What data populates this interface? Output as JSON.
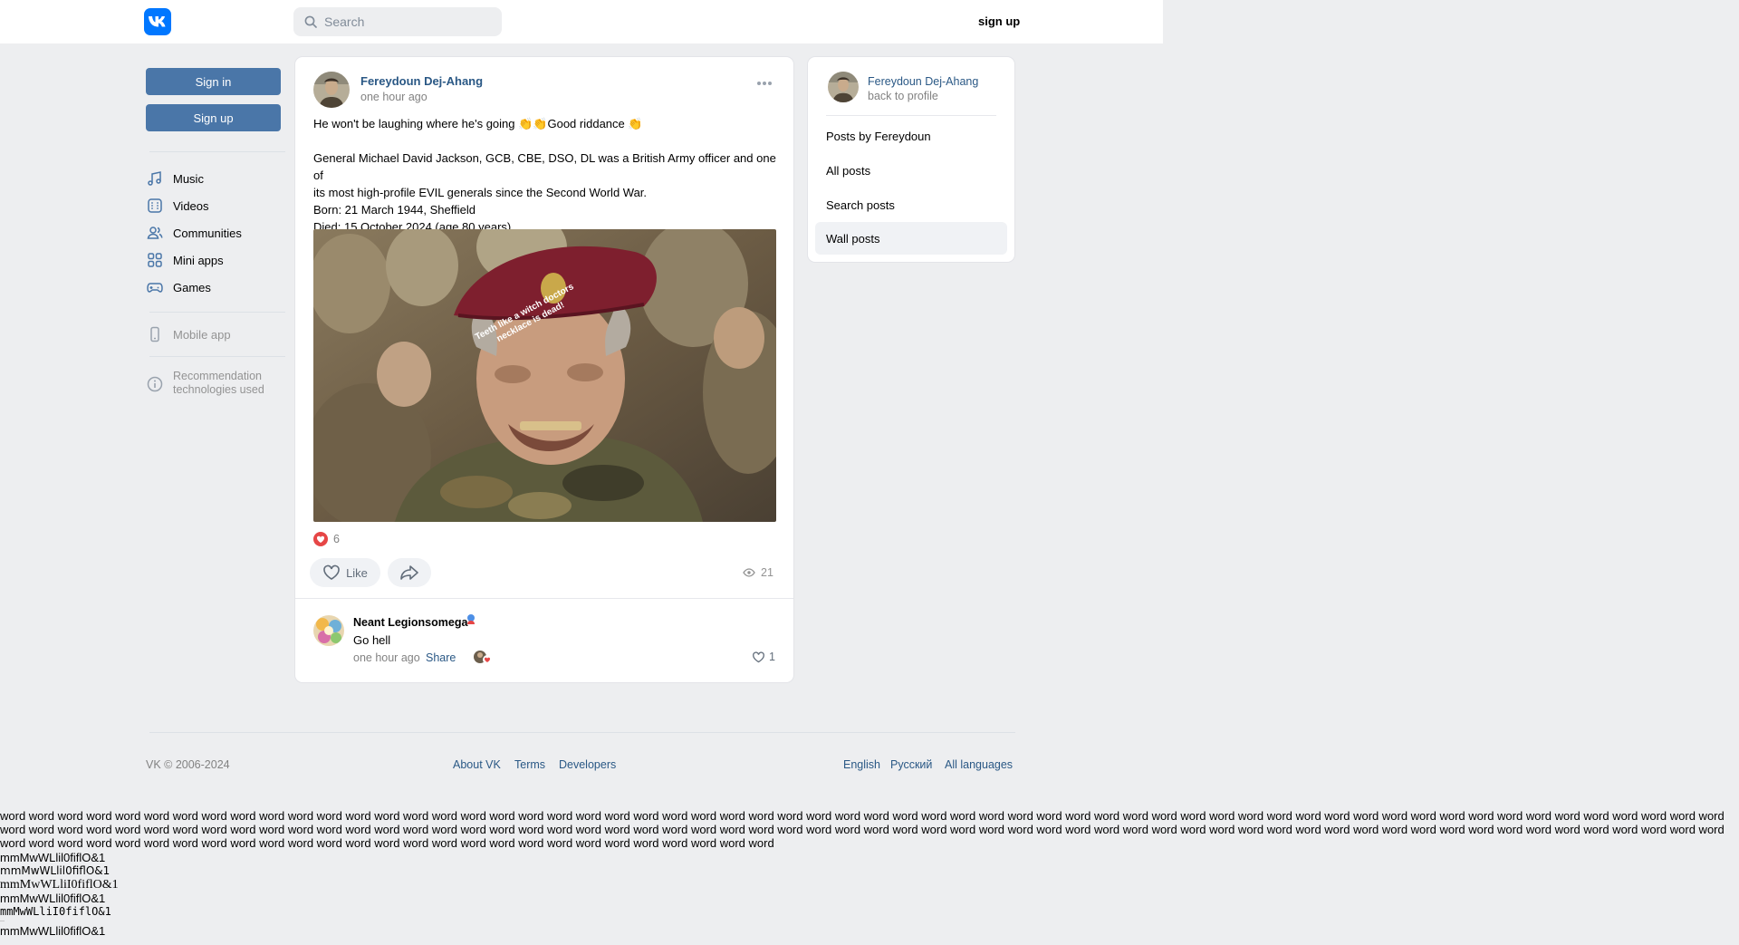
{
  "header": {
    "search_placeholder": "Search",
    "signup_label": "sign up"
  },
  "sidebar": {
    "sign_in": "Sign in",
    "sign_up": "Sign up",
    "items": [
      {
        "label": "Music",
        "icon": "music-icon"
      },
      {
        "label": "Videos",
        "icon": "videos-icon"
      },
      {
        "label": "Communities",
        "icon": "communities-icon"
      },
      {
        "label": "Mini apps",
        "icon": "mini-apps-icon"
      },
      {
        "label": "Games",
        "icon": "games-icon"
      }
    ],
    "mobile_app": "Mobile app",
    "recommendation_line1": "Recommendation",
    "recommendation_line2": "technologies used"
  },
  "post": {
    "author": "Fereydoun Dej-Ahang",
    "time": "one hour ago",
    "line1": "He won't be laughing where he's going 👏👏Good riddance 👏",
    "line2": "General Michael David Jackson, GCB, CBE, DSO, DL was a British Army officer and one of",
    "line3": "its most high-profile EVIL generals since the Second World War.",
    "line4": "Born: 21 March 1944, Sheffield",
    "line5": "Died: 15 October 2024 (age 80 years)",
    "image_caption": "Teeth like a witch doctors necklace is dead!",
    "reactions_count": "6",
    "like_label": "Like",
    "views": "21"
  },
  "comment": {
    "author": "Neant Legionsomega",
    "text": "Go hell",
    "time": "one hour ago",
    "share": "Share",
    "likes": "1"
  },
  "right_panel": {
    "name": "Fereydoun Dej-Ahang",
    "back": "back to profile",
    "items": [
      "Posts by Fereydoun",
      "All posts",
      "Search posts",
      "Wall posts"
    ],
    "active_index": 3
  },
  "footer": {
    "copyright": "VK © 2006-2024",
    "about": "About VK",
    "terms": "Terms",
    "developers": "Developers",
    "english": "English",
    "russian": "Русский",
    "all_languages": "All languages"
  },
  "stray": {
    "words": "word word word word word word word word word word word word word word word word word word word word word word word word word word word word word word word word word word word word word word word word word word word word word word word word word word word word word word word word word word word word word word word word word word word word word word word word word word word word word word word word word word word word word word word word word word word word word word word word word word word word word word word word word word word word word word word word word word word word word word word word word word word word word word word word word word word word word word word word word word word word word word word word word word word",
    "mono1": "mmMwWLlil0fiflO&1",
    "mono2": "mmMwWLlil0fiflO&1",
    "mono3": "mmMwWLliI0fiflO&1",
    "mono4": "mmMwWLlil0fiflO&1",
    "mono5": "mmMwWLliI0fiflO&1",
    "mono6": "mmMwWLlil0fiflO&1"
  },
  "colors": {
    "accent": "#4a76a8",
    "link": "#2a5885",
    "background": "#edeef0",
    "vk_blue": "#0077ff"
  }
}
